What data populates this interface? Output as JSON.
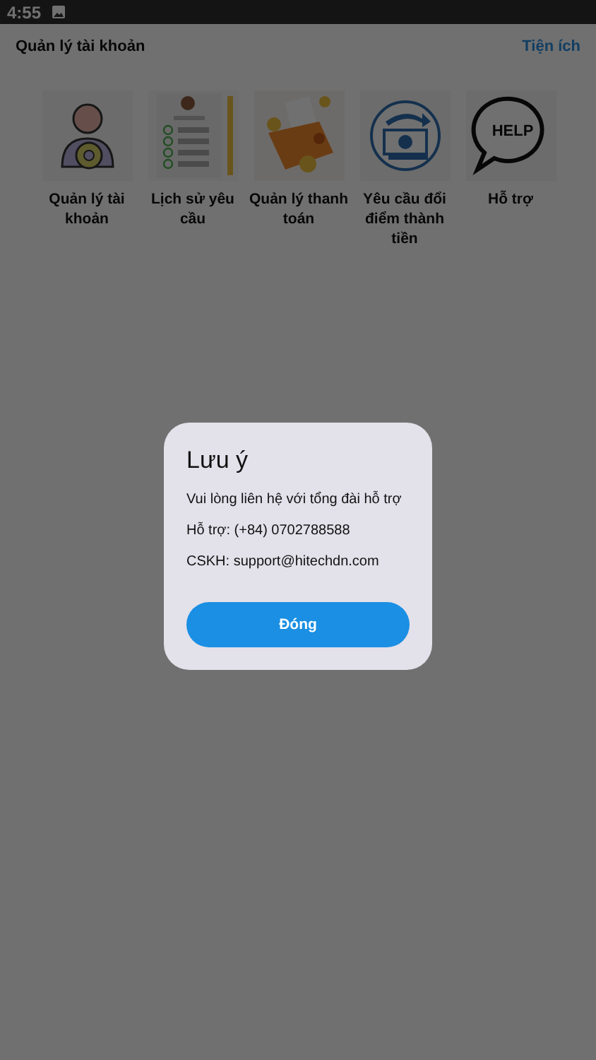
{
  "status_bar": {
    "time": "4:55"
  },
  "header": {
    "title": "Quản lý tài khoản",
    "action": "Tiện ích"
  },
  "tiles": [
    {
      "kind": "account",
      "label": "Quản lý tài khoản"
    },
    {
      "kind": "history",
      "label": "Lịch sử yêu cầu"
    },
    {
      "kind": "payment",
      "label": "Quản lý thanh toán"
    },
    {
      "kind": "exchange",
      "label": "Yêu cầu đổi điểm thành tiền"
    },
    {
      "kind": "help",
      "label": "Hỗ trợ",
      "icon_text": "HELP"
    }
  ],
  "dialog": {
    "title": "Lưu ý",
    "lines": [
      "Vui lòng liên hệ với tổng đài hỗ trợ",
      "Hỗ trợ: (+84) 0702788588",
      "CSKH: support@hitechdn.com"
    ],
    "button": "Đóng"
  }
}
